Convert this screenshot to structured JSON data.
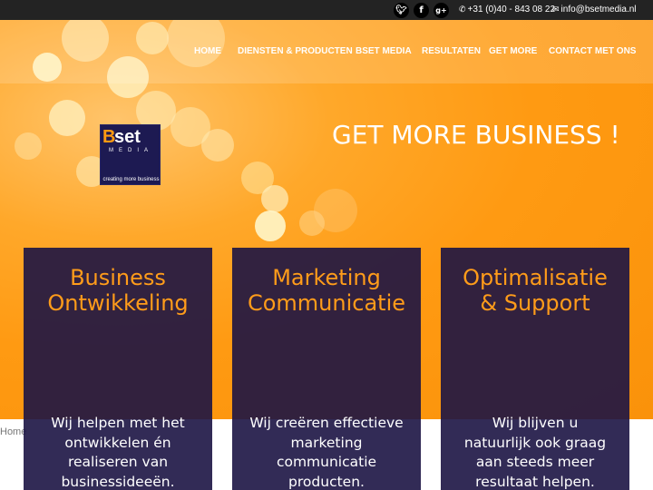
{
  "topbar": {
    "social": [
      {
        "icon": "twitter-icon",
        "glyph": "🐦︎"
      },
      {
        "icon": "facebook-icon",
        "glyph": "f"
      },
      {
        "icon": "google-plus-icon",
        "glyph": "g+"
      }
    ],
    "phone_icon": "phone-icon",
    "phone": "+31 (0)40 - 843 08 22",
    "email_icon": "envelope-icon",
    "email": "info@bsetmedia.nl"
  },
  "nav": {
    "items": [
      "HOME",
      "DIENSTEN & PRODUCTEN",
      "BSET MEDIA",
      "RESULTATEN",
      "GET MORE",
      "CONTACT MET ONS"
    ]
  },
  "logo": {
    "b": "B",
    "set": "set",
    "media": "MEDIA",
    "tagline": "creating more business"
  },
  "hero": {
    "headline": "GET MORE BUSINESS !"
  },
  "breadcrumb": "Home",
  "cards": [
    {
      "title": [
        "Business",
        "Ontwikkeling"
      ],
      "body": [
        "Wij helpen met het",
        "ontwikkelen én",
        "realiseren van",
        "businessideeën."
      ]
    },
    {
      "title": [
        "Marketing",
        "Communicatie"
      ],
      "body": [
        "Wij creëren effectieve",
        "marketing",
        "communicatie",
        "producten."
      ]
    },
    {
      "title": [
        "Optimalisatie",
        "& Support"
      ],
      "body": [
        "Wij blijven u",
        "natuurlijk ook graag",
        "aan steeds meer",
        "resultaat helpen."
      ]
    }
  ],
  "colors": {
    "topbar": "#232323",
    "hero_orange": "#ff9a12",
    "card_bg": "#1c1444",
    "card_title": "#ff9c1a",
    "text_white": "#ffffff"
  }
}
